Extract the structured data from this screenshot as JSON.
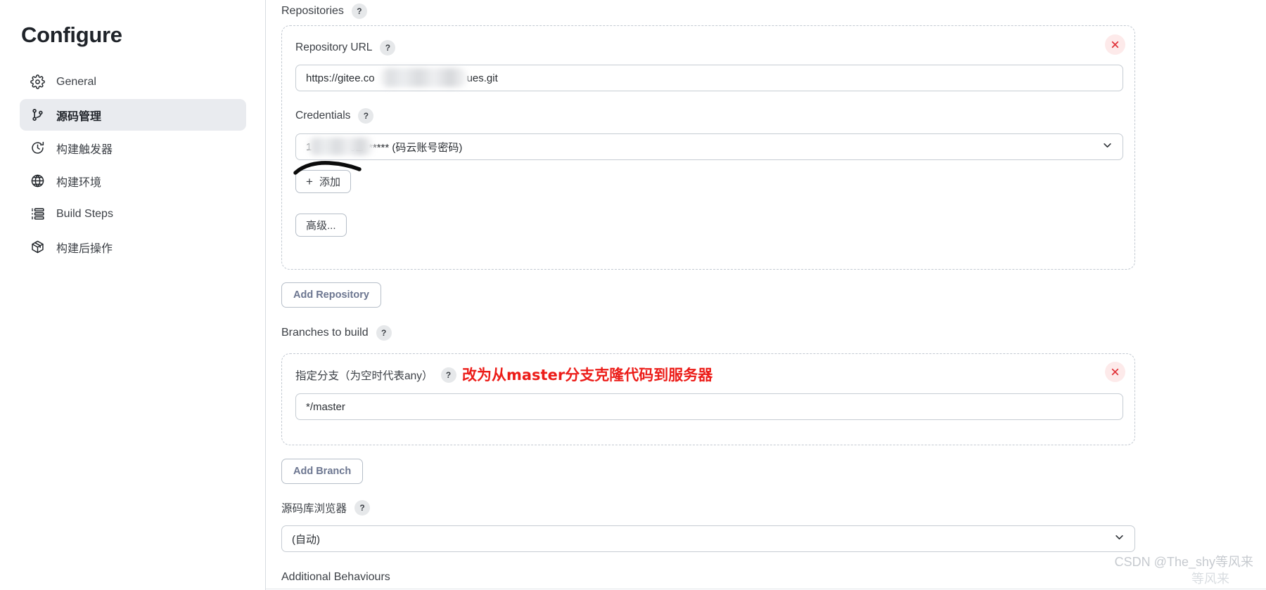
{
  "sidebar": {
    "title": "Configure",
    "items": [
      {
        "label": "General",
        "icon": "gear-icon",
        "active": false
      },
      {
        "label": "源码管理",
        "icon": "source-branch-icon",
        "active": true
      },
      {
        "label": "构建触发器",
        "icon": "clock-icon",
        "active": false
      },
      {
        "label": "构建环境",
        "icon": "globe-icon",
        "active": false
      },
      {
        "label": "Build Steps",
        "icon": "list-icon",
        "active": false
      },
      {
        "label": "构建后操作",
        "icon": "package-icon",
        "active": false
      }
    ]
  },
  "main": {
    "repositories": {
      "section_label": "Repositories",
      "help": "?",
      "repository_url": {
        "label": "Repository URL",
        "help": "?",
        "value_prefix": "https://gitee.co",
        "value_suffix": "ues.git",
        "redacted": true
      },
      "credentials": {
        "label": "Credentials",
        "help": "?",
        "value_prefix": "1",
        "value_suffix": "02/****** (码云账号密码)",
        "redacted": true,
        "chevron": "chevron-down-icon"
      },
      "add_credentials_button": "添加",
      "add_credentials_plus": "+",
      "advanced_button": "高级...",
      "remove_icon": "close-icon"
    },
    "add_repository_button": "Add Repository",
    "branches": {
      "section_label": "Branches to build",
      "help": "?",
      "branch_spec": {
        "label": "指定分支（为空时代表any）",
        "help": "?",
        "value": "*/master"
      },
      "remove_icon": "close-icon"
    },
    "add_branch_button": "Add Branch",
    "repository_browser": {
      "label": "源码库浏览器",
      "help": "?",
      "value": "(自动)",
      "chevron": "chevron-down-icon"
    },
    "additional_behaviours": {
      "label": "Additional Behaviours"
    }
  },
  "annotations": {
    "red_note": "改为从master分支克隆代码到服务器",
    "red_color": "#ec1c18",
    "scribble_color": "#000000"
  },
  "watermark": {
    "line1": "CSDN @The_shy等风来",
    "line2": "等风来"
  }
}
